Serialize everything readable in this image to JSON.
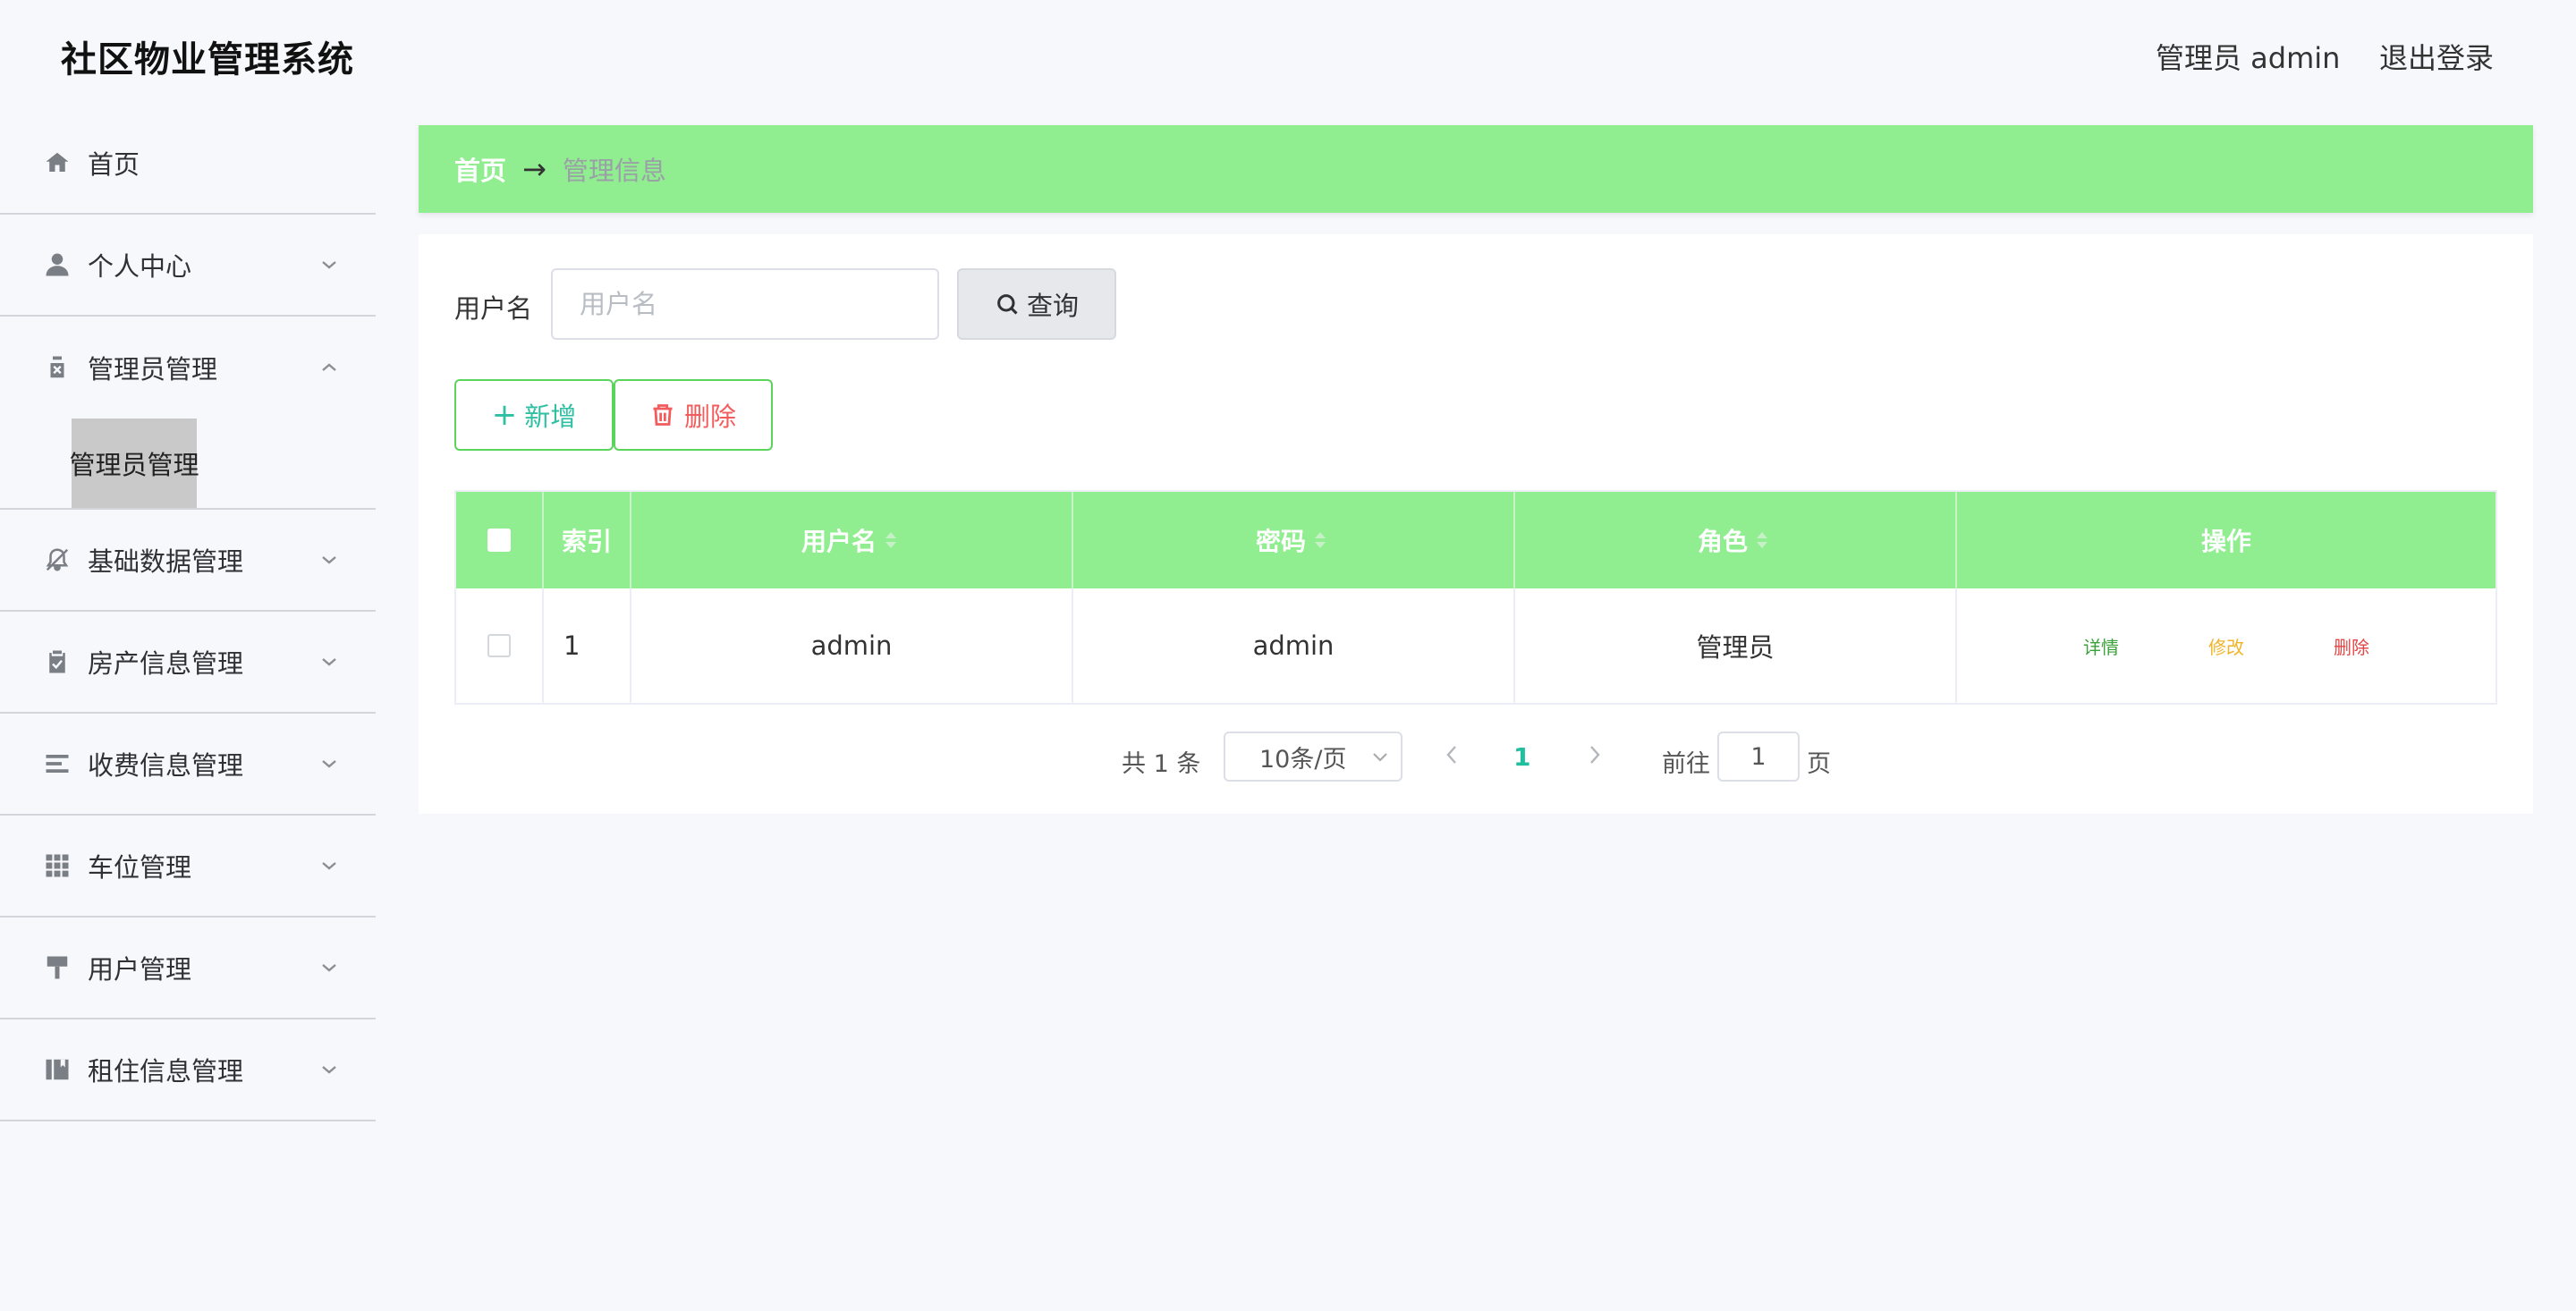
{
  "header": {
    "title": "社区物业管理系统",
    "user": "管理员 admin",
    "logout": "退出登录"
  },
  "sidebar": {
    "items": [
      {
        "label": "首页",
        "icon": "home-icon"
      },
      {
        "label": "个人中心",
        "icon": "user-icon"
      },
      {
        "label": "管理员管理",
        "icon": "clipboard-x-icon",
        "open": true,
        "children": [
          "管理员管理"
        ]
      },
      {
        "label": "基础数据管理",
        "icon": "bell-off-icon"
      },
      {
        "label": "房产信息管理",
        "icon": "clipboard-check-icon"
      },
      {
        "label": "收费信息管理",
        "icon": "list-icon"
      },
      {
        "label": "车位管理",
        "icon": "grid-icon"
      },
      {
        "label": "用户管理",
        "icon": "brush-icon"
      },
      {
        "label": "租住信息管理",
        "icon": "book-icon"
      }
    ]
  },
  "breadcrumb": {
    "home": "首页",
    "separator": "→",
    "current": "管理信息"
  },
  "search": {
    "label": "用户名",
    "placeholder": "用户名",
    "value": "",
    "button": "查询"
  },
  "actions": {
    "add": "新增",
    "delete": "删除"
  },
  "table": {
    "columns": [
      "索引",
      "用户名",
      "密码",
      "角色",
      "操作"
    ],
    "rows": [
      {
        "index": "1",
        "username": "admin",
        "password": "admin",
        "role": "管理员"
      }
    ],
    "ops": {
      "detail": "详情",
      "edit": "修改",
      "delete": "删除"
    }
  },
  "pagination": {
    "total": "共 1 条",
    "page_size": "10条/页",
    "current": "1",
    "goto_label": "前往",
    "goto_value": "1",
    "page_suffix": "页"
  },
  "colors": {
    "accent_green": "#90ee90",
    "teal": "#1fbf9f",
    "danger": "#f25c5c"
  }
}
